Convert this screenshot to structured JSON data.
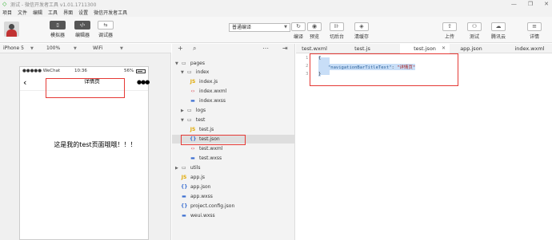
{
  "window": {
    "title": "测试 - 微信开发者工具 v1.01.1711300",
    "controls": [
      "—",
      "❐",
      "✕"
    ]
  },
  "menu": {
    "items": [
      "项目",
      "文件",
      "编辑",
      "工具",
      "界面",
      "设置",
      "微信开发者工具"
    ]
  },
  "toolbar": {
    "simulator_label": "模拟器",
    "editor_label": "编辑器",
    "debugger_label": "调试器",
    "compile_mode": "普通编译",
    "compile_label": "编译",
    "preview_label": "预览",
    "background_label": "切后台",
    "clear_cache_label": "清缓存",
    "upload_label": "上传",
    "test_label": "测试",
    "tencent_cloud_label": "腾讯云",
    "details_label": "详情"
  },
  "device": {
    "model": "iPhone 5",
    "zoom": "100%",
    "network": "WiFi"
  },
  "phone": {
    "carrier": "●●●●● WeChat",
    "time": "10:36",
    "battery": "56%",
    "nav_title": "详情页",
    "page_text": "这是我的test页面哦哦！！！"
  },
  "explorer": {
    "tree": [
      {
        "label": "pages",
        "type": "folder",
        "expanded": true
      },
      {
        "label": "index",
        "type": "folder",
        "expanded": true
      },
      {
        "label": "index.js",
        "type": "js"
      },
      {
        "label": "index.wxml",
        "type": "wxml"
      },
      {
        "label": "index.wxss",
        "type": "wxss"
      },
      {
        "label": "logs",
        "type": "folder",
        "expanded": false
      },
      {
        "label": "test",
        "type": "folder",
        "expanded": true
      },
      {
        "label": "test.js",
        "type": "js"
      },
      {
        "label": "test.json",
        "type": "json",
        "selected": true
      },
      {
        "label": "test.wxml",
        "type": "wxml"
      },
      {
        "label": "test.wxss",
        "type": "wxss"
      },
      {
        "label": "utils",
        "type": "folder",
        "expanded": false
      },
      {
        "label": "app.js",
        "type": "js"
      },
      {
        "label": "app.json",
        "type": "json"
      },
      {
        "label": "app.wxss",
        "type": "wxss"
      },
      {
        "label": "project.config.json",
        "type": "json"
      },
      {
        "label": "weui.wxss",
        "type": "wxss"
      }
    ]
  },
  "editor": {
    "tabs": [
      "test.wxml",
      "test.js",
      "test.json",
      "app.json",
      "index.wxml"
    ],
    "active_tab": "test.json",
    "line_numbers": [
      "1",
      "2",
      "3"
    ],
    "code": {
      "line1": "{",
      "line2_key": "\"navigationBarTitleText\"",
      "line2_sep": ": ",
      "line2_value": "\"详情页\"",
      "line3": "}"
    }
  },
  "colors": {
    "highlight_red": "#e53935",
    "selection_blue": "#c8def7"
  }
}
